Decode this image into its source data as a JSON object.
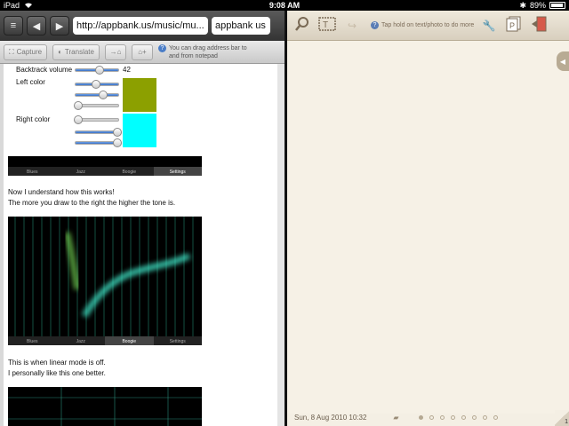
{
  "status_bar": {
    "device": "iPad",
    "time": "9:08 AM",
    "battery": "89%"
  },
  "browser": {
    "url": "http://appbank.us/music/mu...",
    "second_field": "appbank us",
    "toolbar": {
      "capture_label": "Capture",
      "translate_label": "Translate",
      "hint_line1": "You can drag address bar to",
      "hint_line2": "and from notepad"
    },
    "page": {
      "backtrack_label": "Backtrack volume",
      "backtrack_value": "42",
      "left_color_label": "Left color",
      "right_color_label": "Right color",
      "left_color_swatch": "#8ca000",
      "right_color_swatch": "#00ffff",
      "para1_line1": "Now I understand how this works!",
      "para1_line2": "The more you draw to the right the higher the tone is.",
      "para2_line1": "This is when linear mode is off.",
      "para2_line2": "I personally like this one better.",
      "app_tabs": [
        "Blues",
        "Jazz",
        "Boogie",
        "Settings"
      ]
    }
  },
  "notepad": {
    "hint": "Tap hold on text/photo to do more",
    "date": "Sun, 8 Aug 2010 10:32",
    "page_number": "1",
    "page_dots": 8
  }
}
